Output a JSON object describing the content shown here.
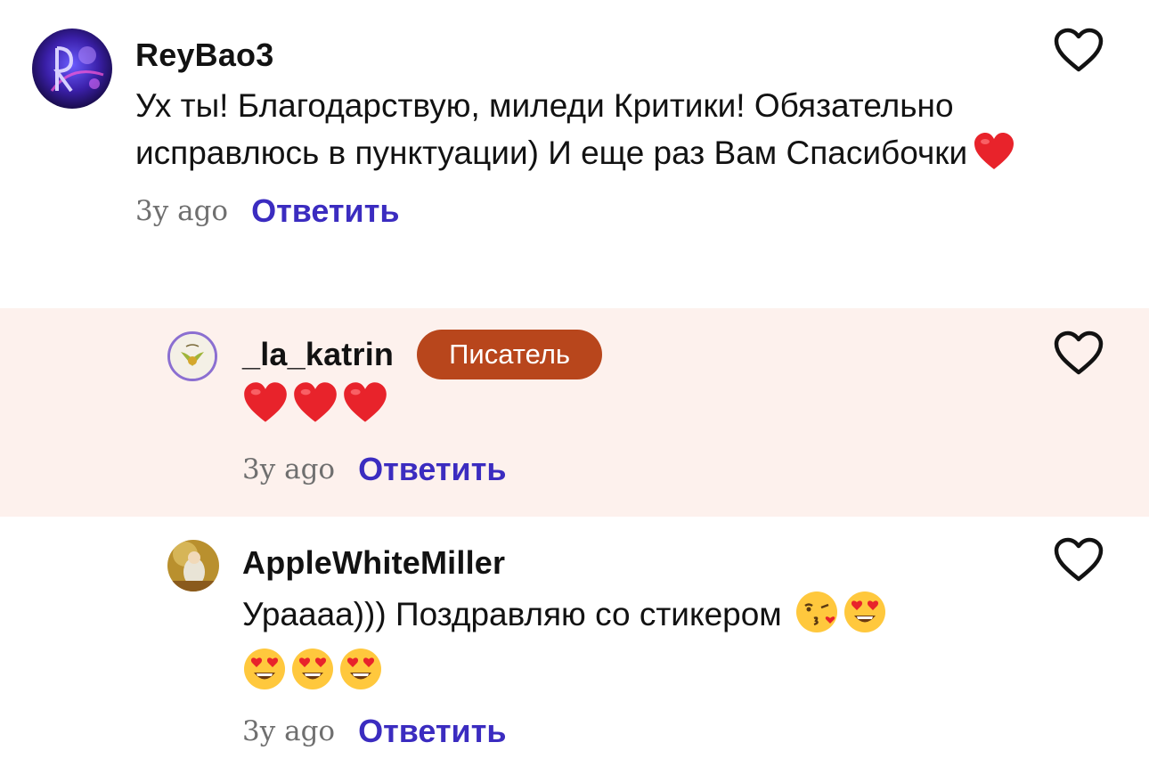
{
  "comments": [
    {
      "username": "ReyBao3",
      "text": "Ух ты! Благодарствую, миледи Критики! Обязательно исправлюсь в пунктуации) И еще раз Вам Спасибочки",
      "time": "3y ago",
      "reply_label": "Ответить",
      "emojis": [
        "red-heart"
      ]
    },
    {
      "username": "_la_katrin",
      "badge": "Писатель",
      "time": "3y ago",
      "reply_label": "Ответить",
      "emojis": [
        "red-heart",
        "red-heart",
        "red-heart"
      ]
    },
    {
      "username": "AppleWhiteMiller",
      "text": "Урaaaa))) Поздравляю со стикером",
      "time": "3y ago",
      "reply_label": "Ответить",
      "emojis": [
        "kissing-face",
        "heart-eyes-face",
        "heart-eyes-face",
        "heart-eyes-face",
        "heart-eyes-face"
      ]
    }
  ],
  "colors": {
    "accent": "#3b2cc0",
    "badge": "#b8461c",
    "highlight_bg": "#fdf1ed",
    "meta_text": "#6f6f6f"
  }
}
